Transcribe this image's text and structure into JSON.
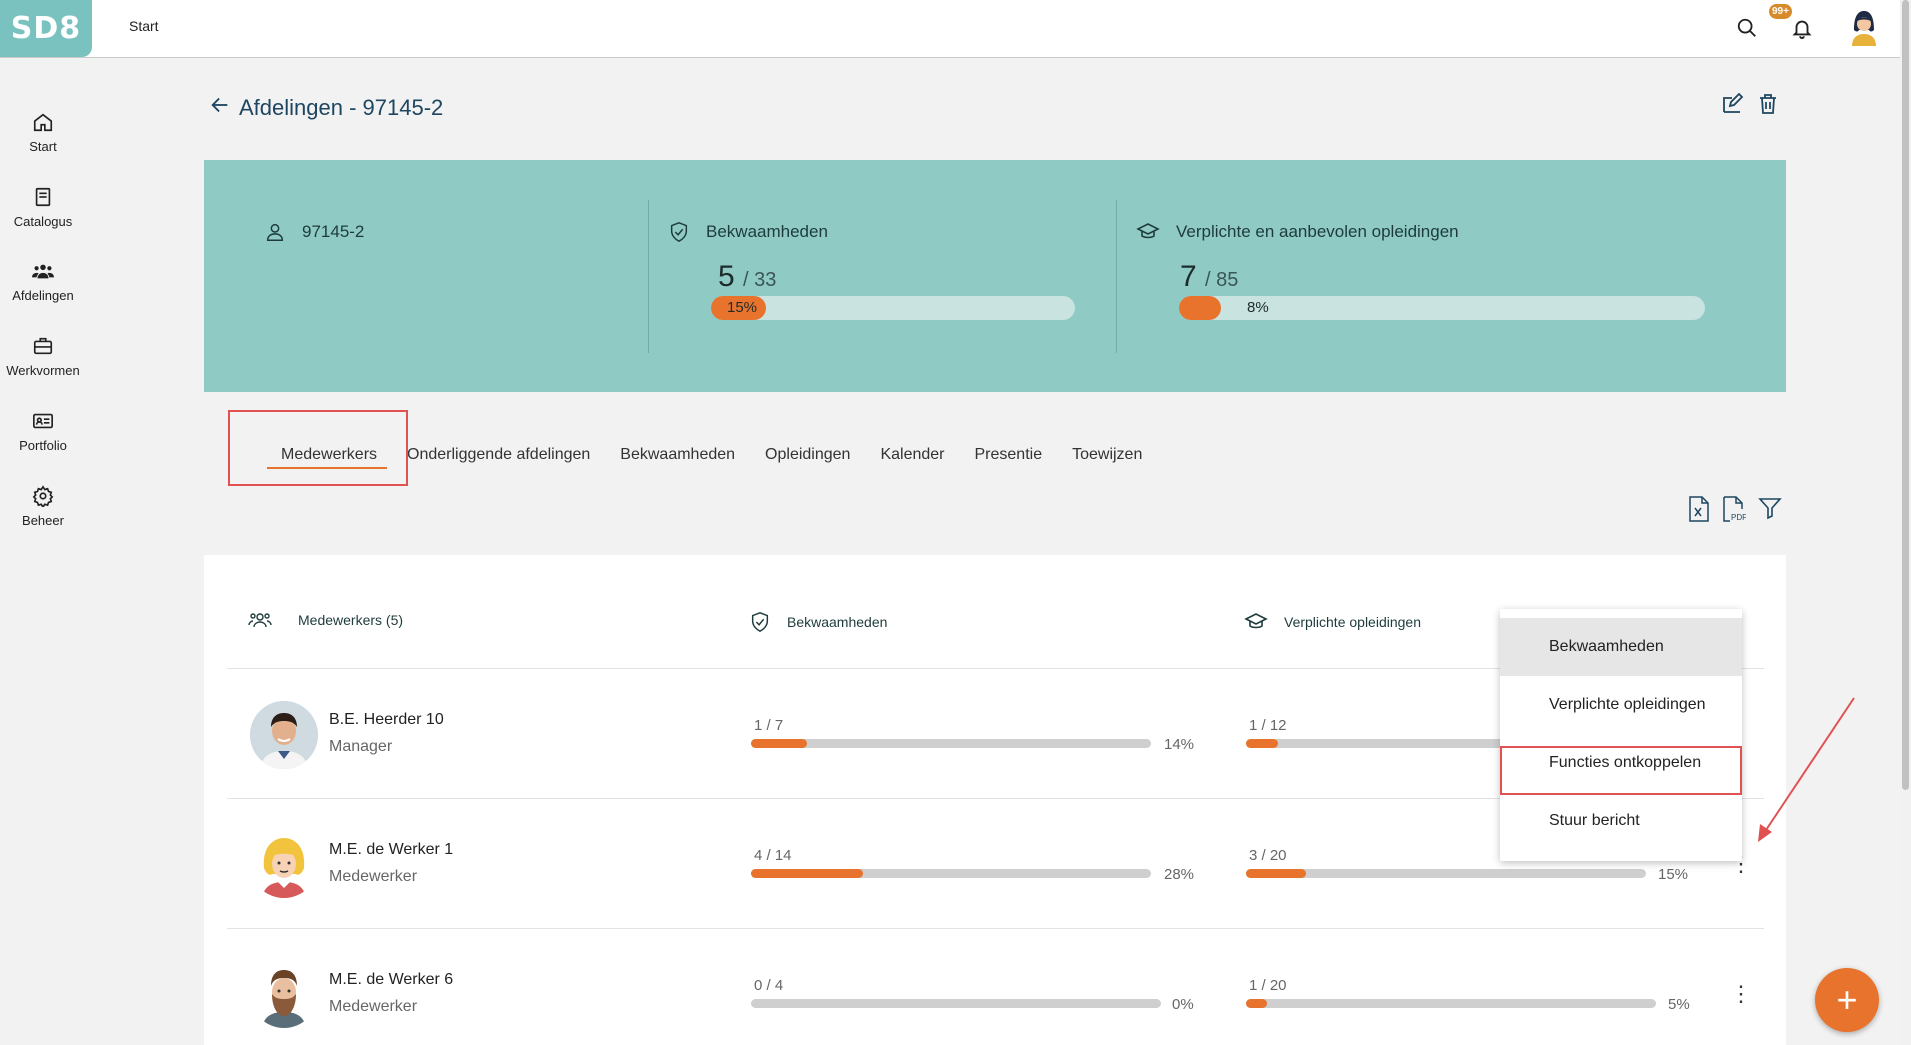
{
  "app": {
    "logo": "SD8",
    "breadcrumb": "Start",
    "notification_badge": "99+"
  },
  "sidebar": {
    "items": [
      {
        "label": "Start",
        "icon": "home-icon"
      },
      {
        "label": "Catalogus",
        "icon": "book-icon"
      },
      {
        "label": "Afdelingen",
        "icon": "group-icon"
      },
      {
        "label": "Werkvormen",
        "icon": "briefcase-icon"
      },
      {
        "label": "Portfolio",
        "icon": "id-card-icon"
      },
      {
        "label": "Beheer",
        "icon": "gear-icon"
      }
    ]
  },
  "page": {
    "title": "Afdelingen - 97145-2"
  },
  "banner": {
    "department": "97145-2",
    "skills": {
      "label": "Bekwaamheden",
      "done": "5",
      "total": "/ 33",
      "percent": "15%",
      "fraction": 0.15
    },
    "trainings": {
      "label": "Verplichte en aanbevolen opleidingen",
      "done": "7",
      "total": "/ 85",
      "percent": "8%",
      "fraction": 0.08
    }
  },
  "tabs": [
    "Medewerkers",
    "Onderliggende afdelingen",
    "Bekwaamheden",
    "Opleidingen",
    "Kalender",
    "Presentie",
    "Toewijzen"
  ],
  "table": {
    "headers": {
      "employees": "Medewerkers (5)",
      "skills": "Bekwaamheden",
      "trainings": "Verplichte opleidingen"
    },
    "rows": [
      {
        "name": "B.E. Heerder 10",
        "role": "Manager",
        "skills_frac": "1 / 7",
        "skills_pct": "14%",
        "skills_fill": 0.14,
        "train_frac": "1 / 12",
        "train_pct": "",
        "train_fill": 0.08
      },
      {
        "name": "M.E. de Werker 1",
        "role": "Medewerker",
        "skills_frac": "4 / 14",
        "skills_pct": "28%",
        "skills_fill": 0.28,
        "train_frac": "3 / 20",
        "train_pct": "15%",
        "train_fill": 0.15
      },
      {
        "name": "M.E. de Werker 6",
        "role": "Medewerker",
        "skills_frac": "0 / 4",
        "skills_pct": "0%",
        "skills_fill": 0.0,
        "train_frac": "1 / 20",
        "train_pct": "5%",
        "train_fill": 0.05
      }
    ]
  },
  "context_menu": {
    "items": [
      "Bekwaamheden",
      "Verplichte opleidingen",
      "Functies ontkoppelen",
      "Stuur bericht"
    ]
  },
  "colors": {
    "accent": "#e8732c",
    "banner": "#8fcbc4",
    "logo": "#79c2bf",
    "highlight": "#e05252"
  }
}
